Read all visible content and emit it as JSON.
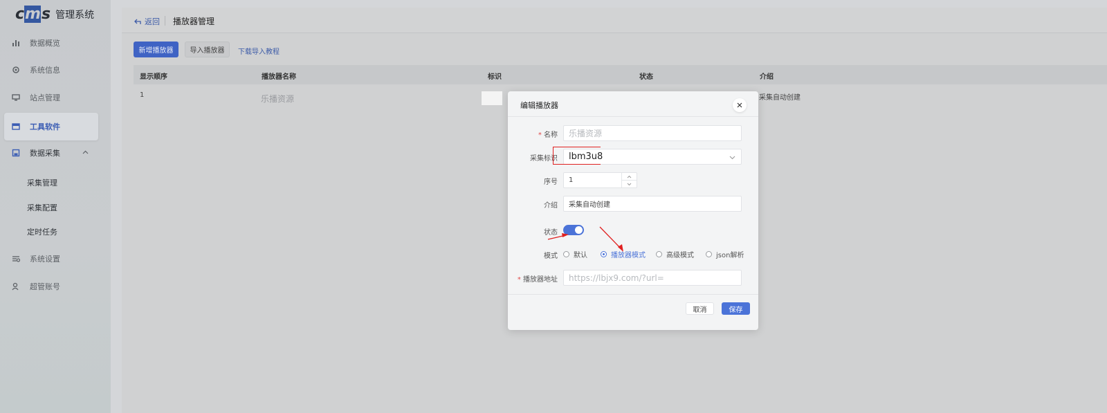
{
  "sidebar": {
    "logo_mark": "cms",
    "logo_text": "管理系统",
    "items": [
      {
        "label": "数据概览",
        "icon": "bar-chart-icon"
      },
      {
        "label": "系统信息",
        "icon": "cog-icon"
      },
      {
        "label": "站点管理",
        "icon": "monitor-icon"
      },
      {
        "label": "工具软件",
        "icon": "window-icon",
        "active": true
      },
      {
        "label": "数据采集",
        "icon": "save-icon",
        "expanded": true
      },
      {
        "label": "系统设置",
        "icon": "sliders-icon"
      },
      {
        "label": "超管账号",
        "icon": "user-icon"
      }
    ],
    "sub_items": [
      "采集管理",
      "采集配置",
      "定时任务"
    ]
  },
  "header": {
    "back_label": "返回",
    "title": "播放器管理"
  },
  "toolbar": {
    "add_label": "新增播放器",
    "import_label": "导入播放器",
    "tutorial_link": "下载导入教程"
  },
  "table": {
    "columns": [
      "显示顺序",
      "播放器名称",
      "标识",
      "状态",
      "介绍"
    ],
    "rows": [
      {
        "order": "1",
        "name": "乐播资源",
        "intro": "采集自动创建"
      }
    ]
  },
  "modal": {
    "title": "编辑播放器",
    "fields": {
      "name_label": "名称",
      "name_placeholder": "乐播资源",
      "tag_label": "采集标识",
      "tag_value": "lbm3u8",
      "order_label": "序号",
      "order_value": "1",
      "intro_label": "介绍",
      "intro_value": "采集自动创建",
      "status_label": "状态",
      "status_on": true,
      "mode_label": "模式",
      "mode_options": [
        "默认",
        "播放器模式",
        "高级模式",
        "json解析"
      ],
      "mode_selected": "播放器模式",
      "url_label": "播放器地址",
      "url_placeholder": "https://lbjx9.com/?url="
    },
    "cancel_label": "取消",
    "save_label": "保存"
  },
  "colors": {
    "accent": "#4b73d8",
    "annotation": "#e02020"
  }
}
